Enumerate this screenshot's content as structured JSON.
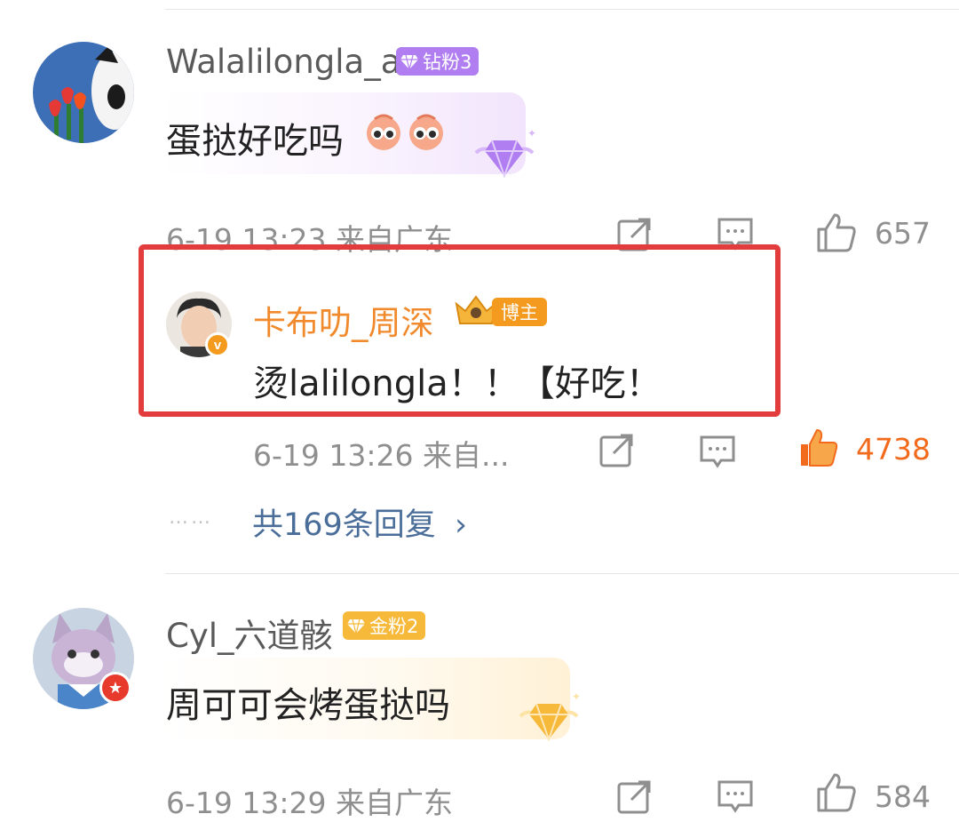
{
  "comments": [
    {
      "username": "Walalilongla_a",
      "badge": "钻粉3",
      "text": "蛋挞好吃吗",
      "meta": "6-19 13:23 来自广东",
      "likes": "657",
      "badge_color": "#b07ef0",
      "avatar_icon": "dog-tulip-avatar",
      "emoji_icon": "eyes-emoji-icon"
    },
    {
      "username": "Cyl_六道骸",
      "badge": "金粉2",
      "text": "周可可会烤蛋挞吗",
      "meta": "6-19 13:29 来自广东",
      "likes": "584",
      "badge_color": "#f6b93a",
      "avatar_icon": "cat-plush-avatar"
    }
  ],
  "reply": {
    "username": "卡布叻_周深",
    "badge": "博主",
    "text": "烫lalilongla！！【好吃！",
    "meta": "6-19 13:26 来自...",
    "likes": "4738",
    "accent": "#f08a2c",
    "highlight_color": "#e23c3c"
  },
  "more_replies": "共169条回复",
  "dots": "……"
}
